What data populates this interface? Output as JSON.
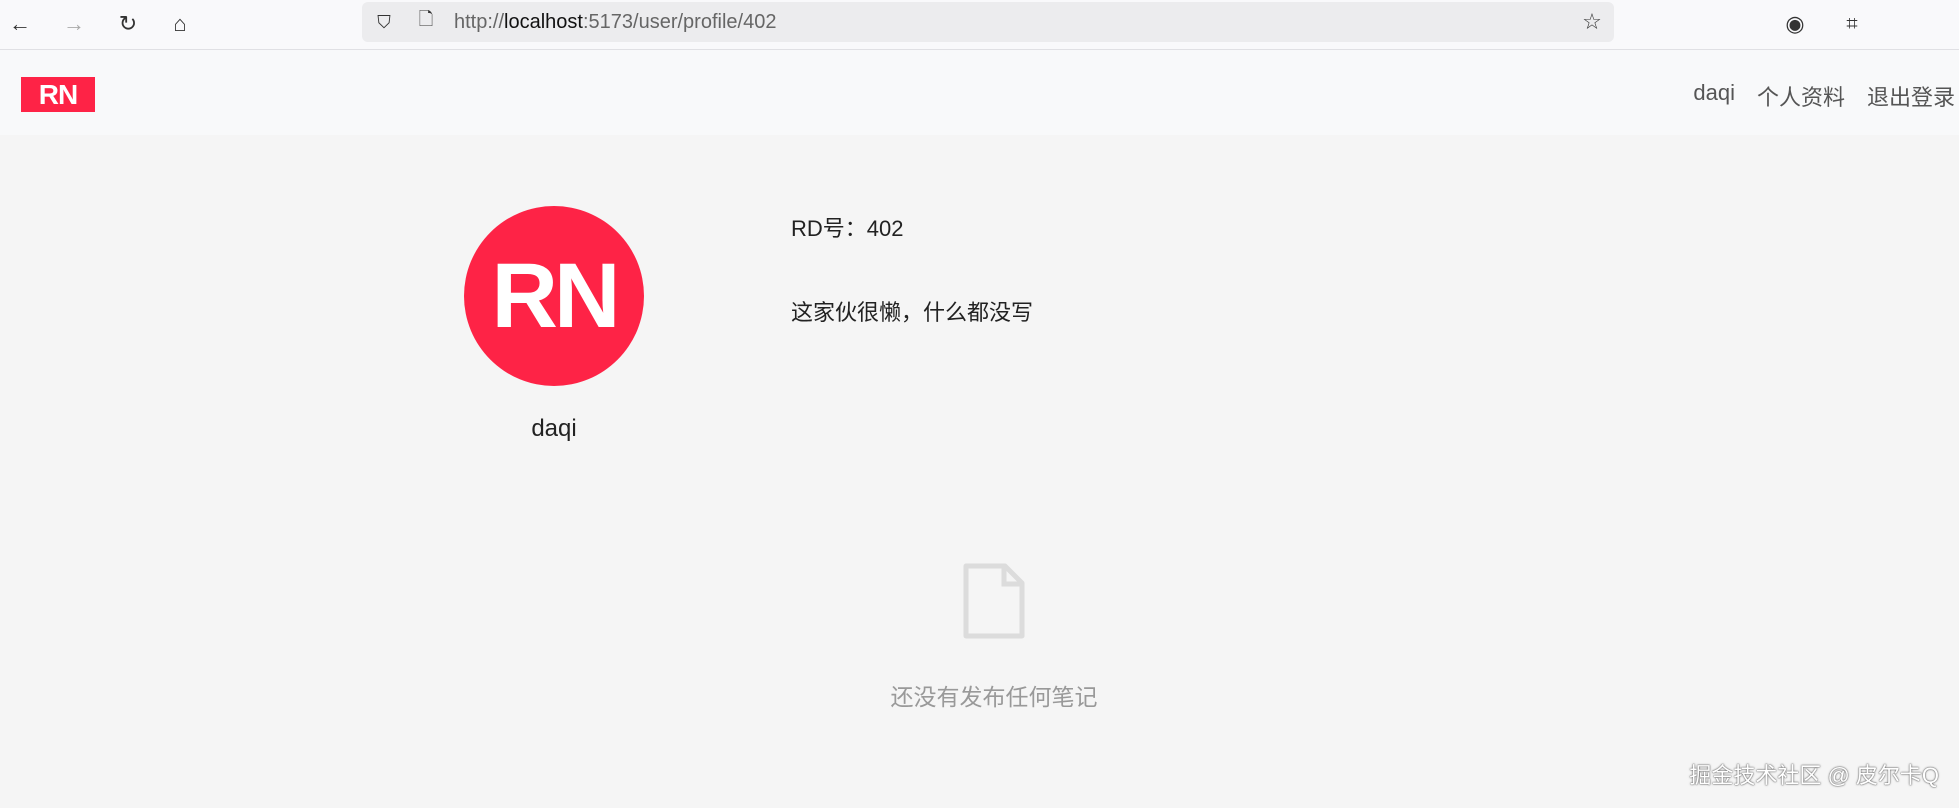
{
  "browser": {
    "url_prefix": "http://",
    "url_host": "localhost",
    "url_rest": ":5173/user/profile/402"
  },
  "header": {
    "logo": "RN",
    "nav": [
      "daqi",
      "个人资料",
      "退出登录"
    ]
  },
  "profile": {
    "avatar_text": "RN",
    "name": "daqi",
    "rd": "RD号：402",
    "bio": "这家伙很懒，什么都没写"
  },
  "empty": {
    "text": "还没有发布任何笔记"
  },
  "watermark": "掘金技术社区 @ 皮尔卡Q"
}
